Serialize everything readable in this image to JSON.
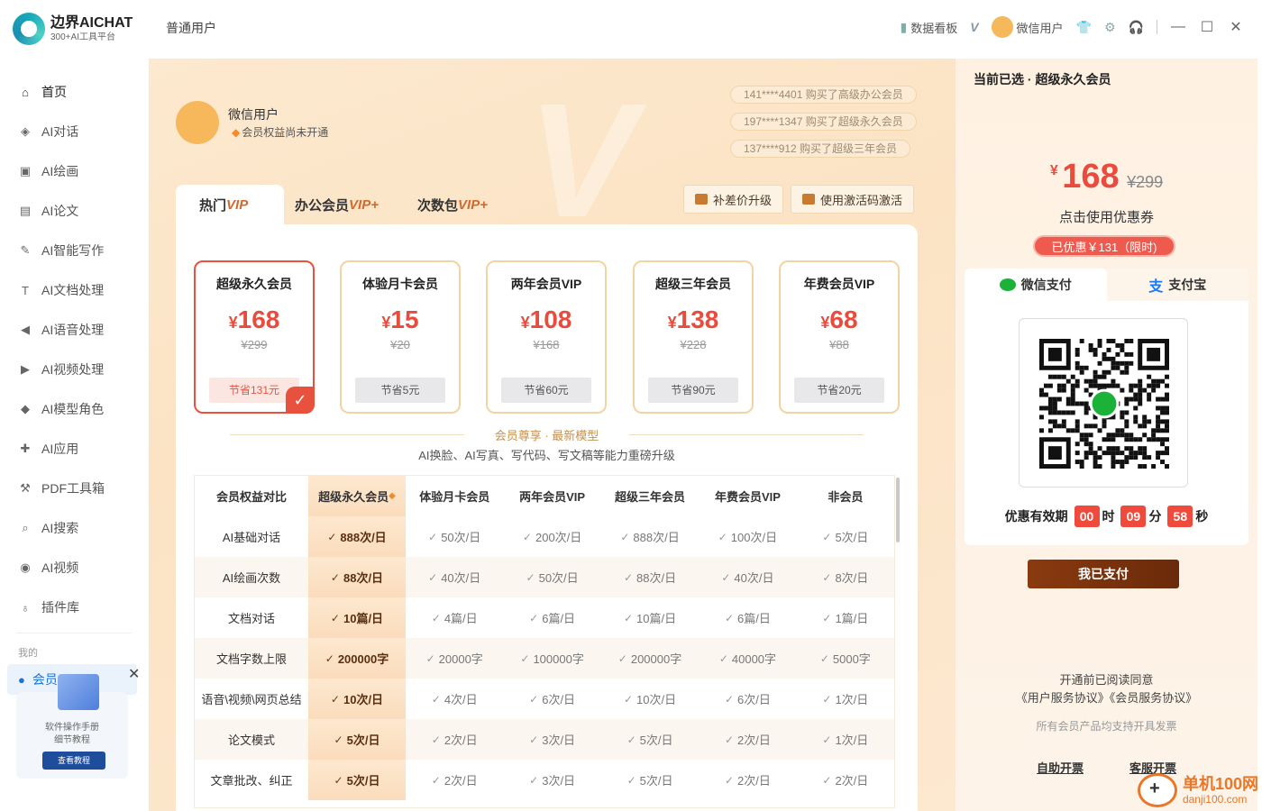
{
  "app": {
    "logo_title": "边界AICHAT",
    "logo_sub": "300+AI工具平台",
    "user_type": "普通用户"
  },
  "topbar": {
    "dashboard": "数据看板",
    "user": "微信用户"
  },
  "sidebar": {
    "items": [
      {
        "label": "首页",
        "icon": "home-icon"
      },
      {
        "label": "AI对话",
        "icon": "cube-icon"
      },
      {
        "label": "AI绘画",
        "icon": "image-icon"
      },
      {
        "label": "AI论文",
        "icon": "document-icon"
      },
      {
        "label": "AI智能写作",
        "icon": "pen-icon"
      },
      {
        "label": "AI文档处理",
        "icon": "text-doc-icon"
      },
      {
        "label": "AI语音处理",
        "icon": "speaker-icon"
      },
      {
        "label": "AI视频处理",
        "icon": "video-icon"
      },
      {
        "label": "AI模型角色",
        "icon": "model-icon"
      },
      {
        "label": "AI应用",
        "icon": "apps-icon"
      },
      {
        "label": "PDF工具箱",
        "icon": "wrench-icon"
      },
      {
        "label": "AI搜索",
        "icon": "search-icon"
      },
      {
        "label": "AI视频",
        "icon": "play-icon"
      },
      {
        "label": "插件库",
        "icon": "bulb-icon"
      }
    ],
    "mine_label": "我的",
    "mine_item": "会员",
    "promo_line1": "软件操作手册",
    "promo_line2": "细节教程",
    "promo_button": "查看教程"
  },
  "main": {
    "user_name": "微信用户",
    "user_status": "会员权益尚未开通",
    "tickers": [
      "141****4401 购买了高级办公会员",
      "197****1347 购买了超级永久会员",
      "137****912 购买了超级三年会员"
    ],
    "tabs": [
      {
        "label": "热门",
        "mark": "VIP"
      },
      {
        "label": "办公会员",
        "mark": "VIP+"
      },
      {
        "label": "次数包",
        "mark": "VIP+"
      }
    ],
    "upgrade_button": "补差价升级",
    "activate_button": "使用激活码激活",
    "plans": [
      {
        "name": "超级永久会员",
        "price": "168",
        "orig": "¥299",
        "save": "节省131元",
        "selected": true
      },
      {
        "name": "体验月卡会员",
        "price": "15",
        "orig": "¥20",
        "save": "节省5元",
        "selected": false
      },
      {
        "name": "两年会员VIP",
        "price": "108",
        "orig": "¥168",
        "save": "节省60元",
        "selected": false
      },
      {
        "name": "超级三年会员",
        "price": "138",
        "orig": "¥228",
        "save": "节省90元",
        "selected": false
      },
      {
        "name": "年费会员VIP",
        "price": "68",
        "orig": "¥88",
        "save": "节省20元",
        "selected": false
      }
    ],
    "section_title": "会员尊享 · 最新模型",
    "section_sub": "AI换脸、AI写真、写代码、写文稿等能力重磅升级",
    "table": {
      "headers": [
        "会员权益对比",
        "超级永久会员",
        "体验月卡会员",
        "两年会员VIP",
        "超级三年会员",
        "年费会员VIP",
        "非会员"
      ],
      "rows": [
        [
          "AI基础对话",
          "888次/日",
          "50次/日",
          "200次/日",
          "888次/日",
          "100次/日",
          "5次/日"
        ],
        [
          "AI绘画次数",
          "88次/日",
          "40次/日",
          "50次/日",
          "88次/日",
          "40次/日",
          "8次/日"
        ],
        [
          "文档对话",
          "10篇/日",
          "4篇/日",
          "6篇/日",
          "10篇/日",
          "6篇/日",
          "1篇/日"
        ],
        [
          "文档字数上限",
          "200000字",
          "20000字",
          "100000字",
          "200000字",
          "40000字",
          "5000字"
        ],
        [
          "语音\\视频\\网页总结",
          "10次/日",
          "4次/日",
          "6次/日",
          "10次/日",
          "6次/日",
          "1次/日"
        ],
        [
          "论文模式",
          "5次/日",
          "2次/日",
          "3次/日",
          "5次/日",
          "2次/日",
          "1次/日"
        ],
        [
          "文章批改、纠正",
          "5次/日",
          "2次/日",
          "3次/日",
          "5次/日",
          "2次/日",
          "2次/日"
        ]
      ]
    }
  },
  "pay": {
    "title": "当前已选 · 超级永久会员",
    "yen": "¥",
    "price": "168",
    "orig": "¥299",
    "coupon": "点击使用优惠券",
    "discount": "已优惠￥131（限时)",
    "wechat": "微信支付",
    "alipay": "支付宝",
    "timer_label": "优惠有效期",
    "hours": "00",
    "h_unit": "时",
    "minutes": "09",
    "m_unit": "分",
    "seconds": "58",
    "s_unit": "秒",
    "paid_button": "我已支付",
    "agree1": "开通前已阅读同意",
    "agree_user": "《用户服务协议》",
    "agree_member": "《会员服务协议》",
    "invoice_note": "所有会员产品均支持开具发票",
    "self_invoice": "自助开票",
    "service_invoice": "客服开票"
  },
  "watermark": {
    "line1": "单机100网",
    "line2": "danji100.com"
  }
}
